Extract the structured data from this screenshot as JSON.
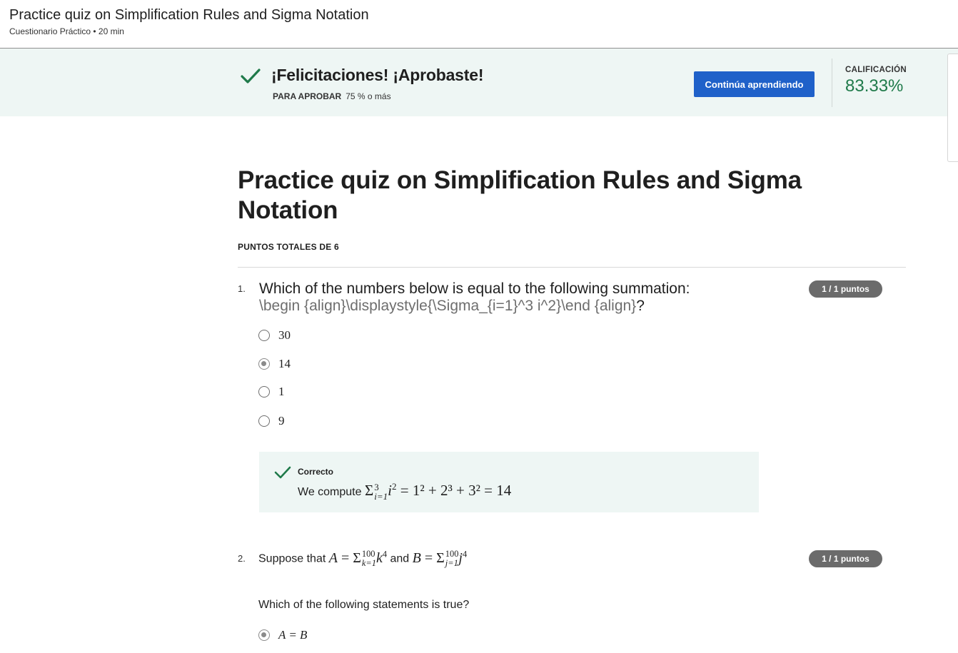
{
  "header": {
    "title": "Practice quiz on Simplification Rules and Sigma Notation",
    "subtitle": "Cuestionario Práctico • 20 min"
  },
  "banner": {
    "title": "¡Felicitaciones! ¡Aprobaste!",
    "pass_label": "PARA APROBAR",
    "pass_value": "75 % o más",
    "cta_label": "Continúa aprendiendo",
    "grade_label": "CALIFICACIÓN",
    "grade_value": "83.33%",
    "accent_color": "#1f7a4a",
    "button_color": "#1f61c9"
  },
  "quiz": {
    "title": "Practice quiz on Simplification Rules and Sigma Notation",
    "total_points": "PUNTOS TOTALES DE 6",
    "questions": [
      {
        "number": "1.",
        "text": "Which of the numbers below is equal to the following summation:",
        "latex_raw": "\\begin {align}\\displaystyle{\\Sigma_{i=1}^3 i^2}\\end {align}",
        "latex_suffix": "?",
        "points": "1 / 1 puntos",
        "options": [
          "30",
          "14",
          "1",
          "9"
        ],
        "selected_index": 1,
        "feedback": {
          "status": "Correcto",
          "prefix": "We compute",
          "eq_lhs_upper": "3",
          "eq_lhs_lower": "i=1",
          "eq_rhs": "= 1² + 2³ + 3² = 14"
        }
      },
      {
        "number": "2.",
        "text_prefix": "Suppose that",
        "text_and": "and",
        "a_upper": "100",
        "a_lower": "k=1",
        "b_upper": "100",
        "b_lower": "j=1",
        "points": "1 / 1 puntos",
        "subtext": "Which of the following statements is true?",
        "options": [
          "A = B"
        ],
        "selected_index": 0
      }
    ]
  }
}
